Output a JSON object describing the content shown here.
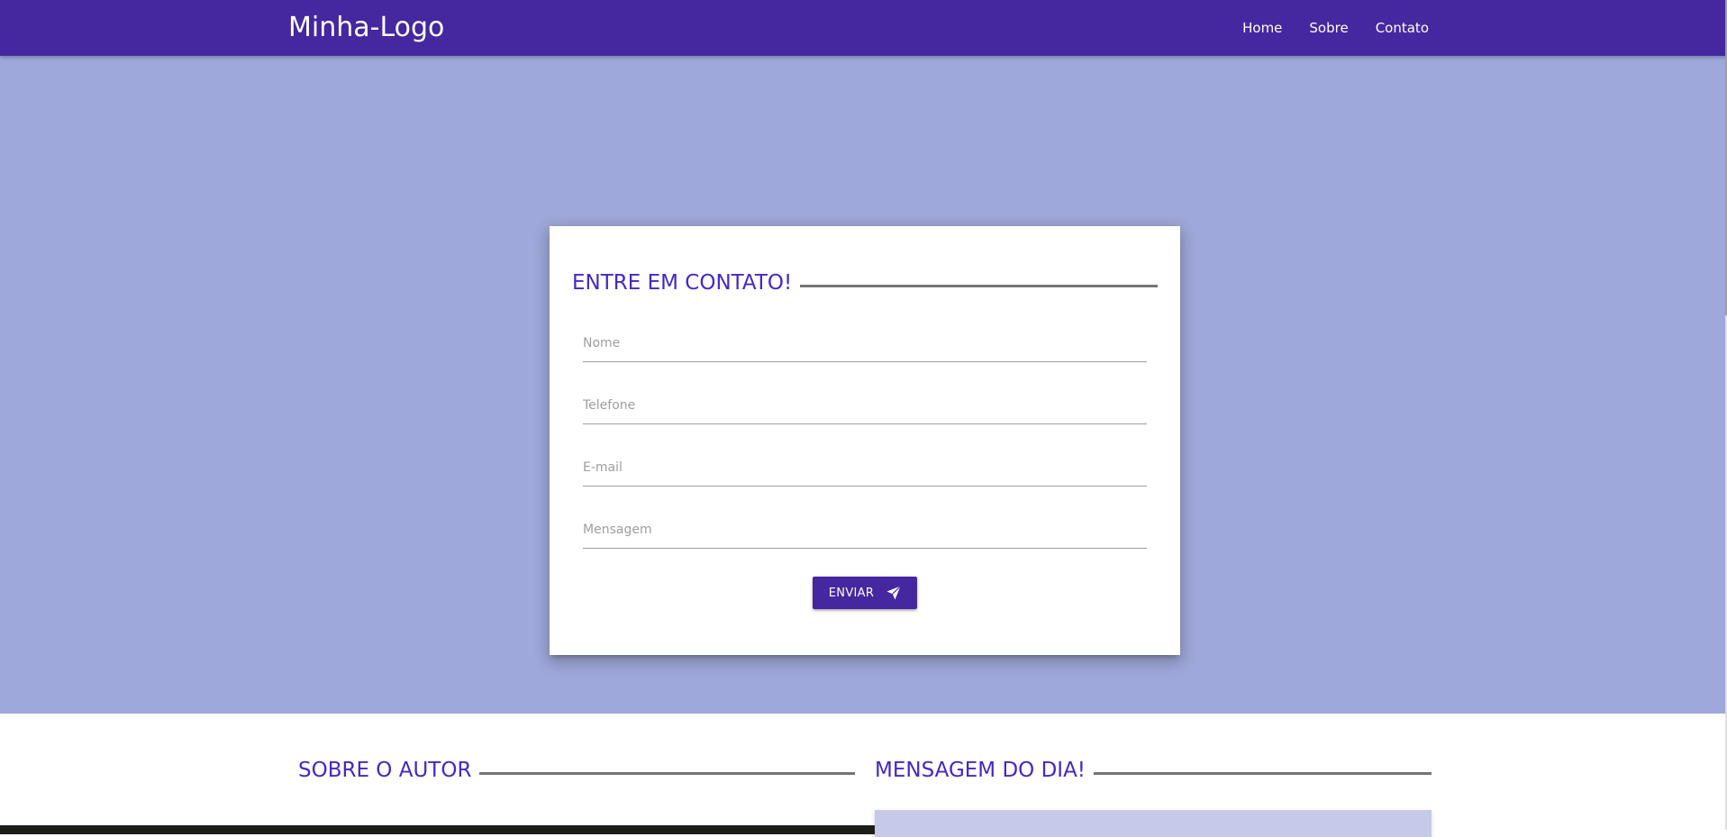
{
  "navbar": {
    "brand": "Minha-Logo",
    "links": [
      {
        "label": "Home"
      },
      {
        "label": "Sobre"
      },
      {
        "label": "Contato"
      }
    ]
  },
  "contact": {
    "title": "ENTRE EM CONTATO!",
    "fields": {
      "name": {
        "placeholder": "Nome",
        "value": ""
      },
      "phone": {
        "placeholder": "Telefone",
        "value": ""
      },
      "email": {
        "placeholder": "E-mail",
        "value": ""
      },
      "message": {
        "placeholder": "Mensagem",
        "value": ""
      }
    },
    "submit_label": "ENVIAR",
    "submit_icon": "send-icon"
  },
  "about": {
    "title": "SOBRE O AUTOR"
  },
  "daily_message": {
    "title": "MENSAGEM DO DIA!"
  },
  "colors": {
    "primary": "#4527a0",
    "hero_background": "#9fa8da",
    "title_text": "#4527c9",
    "divider": "#757575",
    "message_box": "#c5cae9"
  }
}
